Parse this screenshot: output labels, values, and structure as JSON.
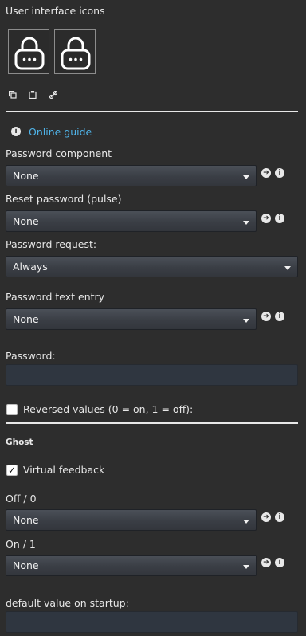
{
  "header": {
    "title": "User interface icons"
  },
  "icons": [
    "lock-icon",
    "lock-icon"
  ],
  "toolbar": {
    "copy_icon": "copy-icon",
    "paste_icon": "clipboard-icon",
    "link_icon": "link-icon"
  },
  "guide": {
    "label": "Online guide",
    "info_symbol": "i"
  },
  "password_component": {
    "label": "Password component",
    "value": "None"
  },
  "reset_password": {
    "label": "Reset password (pulse)",
    "value": "None"
  },
  "password_request": {
    "label": "Password request:",
    "value": "Always"
  },
  "password_text_entry": {
    "label": "Password text entry",
    "value": "None"
  },
  "password": {
    "label": "Password:",
    "value": ""
  },
  "reversed_values": {
    "label": "Reversed values (0 = on, 1 = off):",
    "checked": false
  },
  "ghost": {
    "title": "Ghost"
  },
  "virtual_feedback": {
    "label": "Virtual feedback",
    "checked": true,
    "check_mark": "✓"
  },
  "off_state": {
    "label": "Off / 0",
    "value": "None"
  },
  "on_state": {
    "label": "On / 1",
    "value": "None"
  },
  "default_value": {
    "label": "default value on startup:",
    "value": ""
  },
  "side_icons": {
    "arrow_symbol": "➔",
    "info_symbol": "i"
  },
  "colors": {
    "background": "#2d2d2d",
    "link": "#4fb3e8",
    "select_bg": "#3a3e45",
    "input_bg": "#2f3640"
  }
}
